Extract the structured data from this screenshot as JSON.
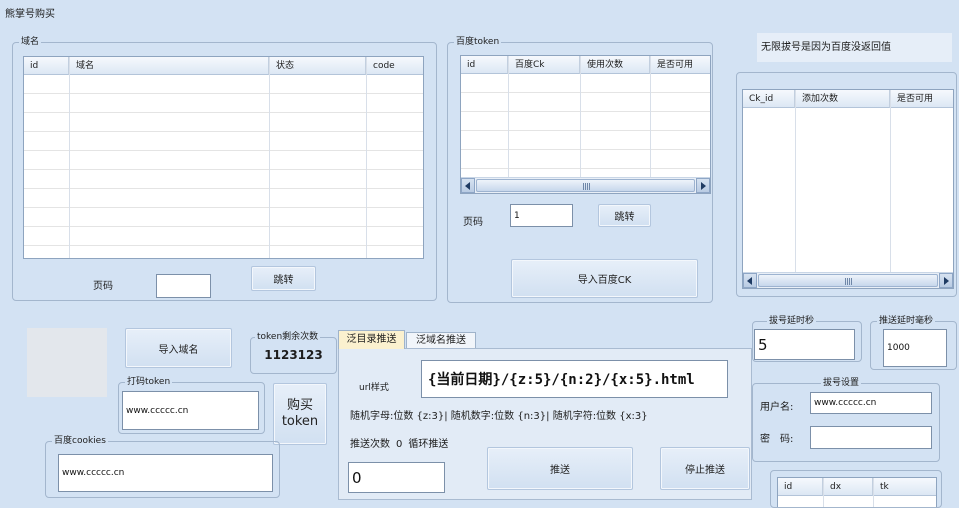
{
  "window": {
    "title": "熊掌号购买"
  },
  "domain_group": {
    "title": "域名",
    "columns": [
      "id",
      "域名",
      "状态",
      "code"
    ],
    "page_label": "页码",
    "page_value": "",
    "jump_label": "跳转"
  },
  "baidu_token_group": {
    "title": "百度token",
    "columns": [
      "id",
      "百度Ck",
      "使用次数",
      "是否可用"
    ],
    "page_label": "页码",
    "page_value": "1",
    "jump_label": "跳转",
    "import_label": "导入百度CK"
  },
  "notice": "无限拔号是因为百度没返回值",
  "ck_list": {
    "columns": [
      "Ck_id",
      "添加次数",
      "是否可用"
    ]
  },
  "import_domain_label": "导入域名",
  "token_remaining": {
    "title": "token剩余次数",
    "value": "1123123"
  },
  "captcha_token": {
    "title": "打码token",
    "value": "www.ccccc.cn"
  },
  "buy_token": {
    "line1": "购买",
    "line2": "token"
  },
  "baidu_cookies": {
    "title": "百度cookies",
    "value": "www.ccccc.cn"
  },
  "push_tabs": {
    "tabs": [
      {
        "label": "泛目录推送",
        "selected": true
      },
      {
        "label": "泛域名推送",
        "selected": false
      }
    ],
    "url_label": "url样式",
    "url_value": "{当前日期}/{z:5}/{n:2}/{x:5}.html",
    "help_text": "随机字母:位数 {z:3}| 随机数字:位数 {n:3}| 随机字符:位数 {x:3}",
    "count_label": "推送次数",
    "count_value": "0",
    "loop_label": "循环推送",
    "count_input_value": "0",
    "push_label": "推送",
    "stop_label": "停止推送"
  },
  "dial_delay": {
    "title": "拔号延时秒",
    "value": "5"
  },
  "push_delay": {
    "title": "推送延时毫秒",
    "value": "1000"
  },
  "dial_settings": {
    "title": "拔号设置",
    "username_label": "用户名:",
    "username_value": "www.ccccc.cn",
    "password_label": "密　码:",
    "password_value": ""
  },
  "result_list": {
    "columns": [
      "id",
      "dx",
      "tk"
    ]
  },
  "colors": {
    "window_bg": "#d3e2f3",
    "panel_bg": "#e2ebf6",
    "selected_tab_bg": "#fbf1cf",
    "list_bg": "#ffffff",
    "border": "#a3b6cd"
  }
}
